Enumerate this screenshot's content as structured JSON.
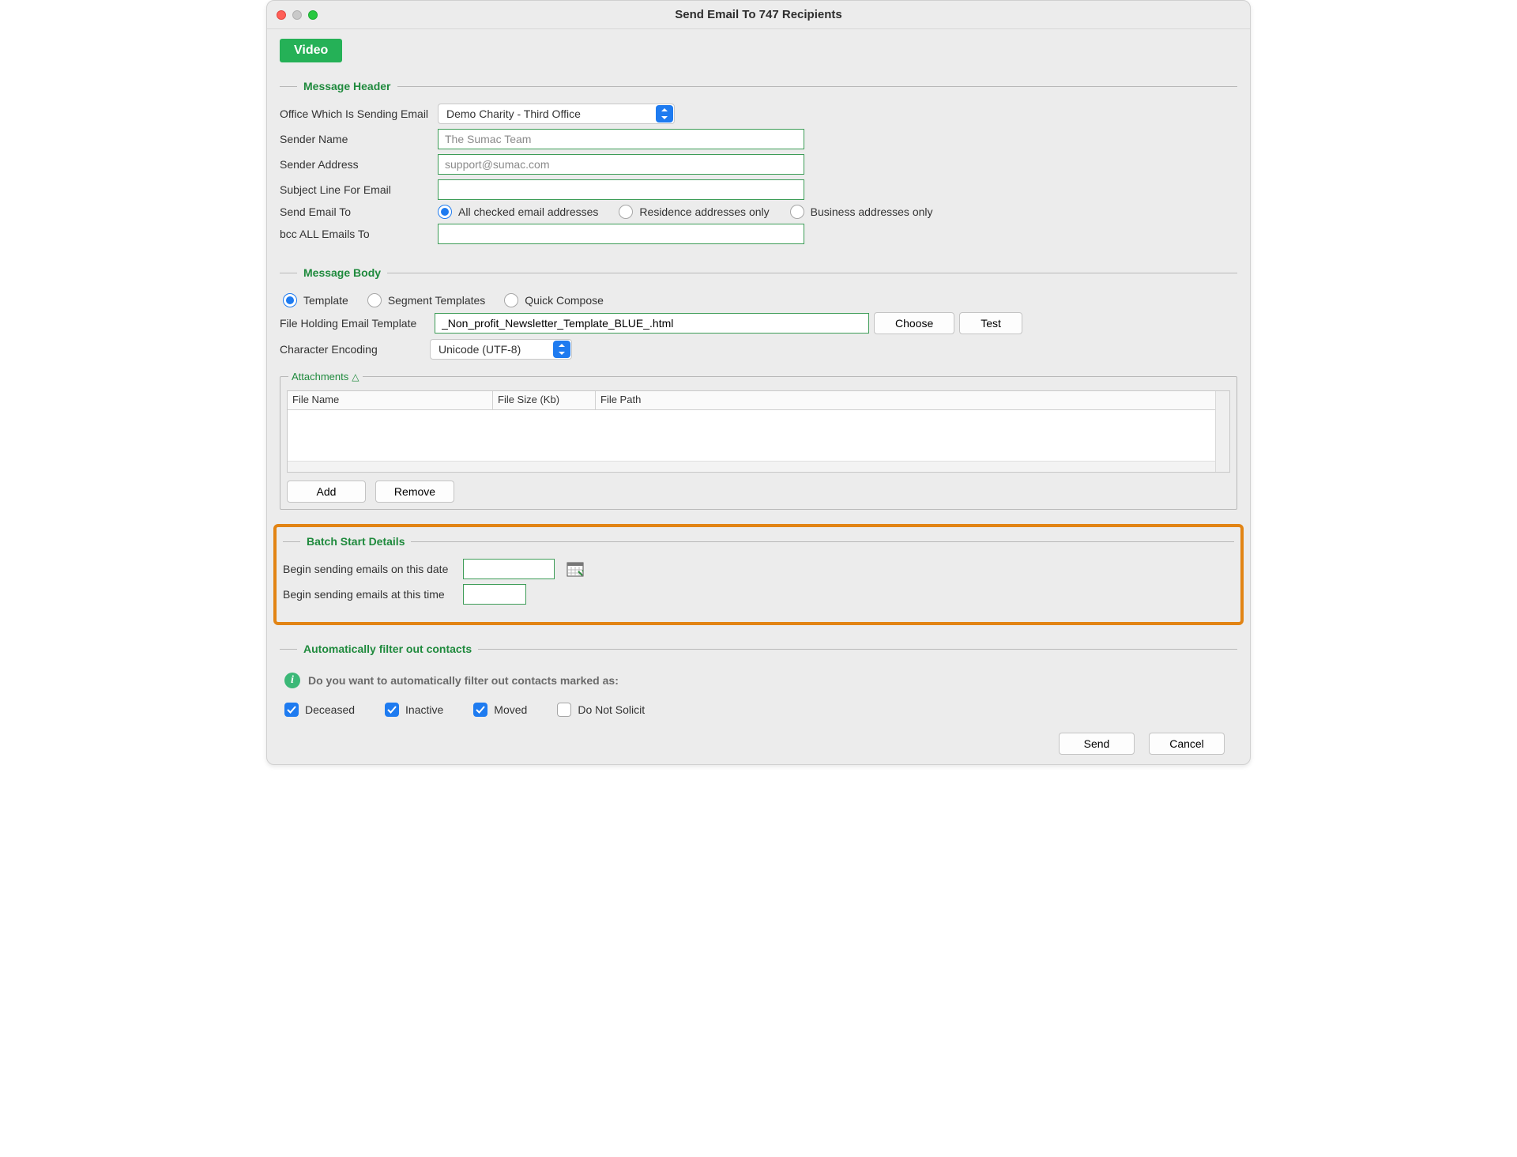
{
  "window": {
    "title": "Send Email To 747 Recipients"
  },
  "video_button": "Video",
  "sections": {
    "header": "Message Header",
    "body": "Message Body",
    "attachments": "Attachments",
    "batch": "Batch Start Details",
    "filter": "Automatically filter out contacts"
  },
  "header": {
    "office_label": "Office Which Is Sending Email",
    "office_value": "Demo Charity - Third Office",
    "sender_name_label": "Sender Name",
    "sender_name_value": "The Sumac Team",
    "sender_addr_label": "Sender Address",
    "sender_addr_value": "support@sumac.com",
    "subject_label": "Subject Line For Email",
    "subject_value": "",
    "send_to_label": "Send Email To",
    "send_to_options": {
      "all": "All checked email addresses",
      "residence": "Residence addresses only",
      "business": "Business addresses only"
    },
    "bcc_label": "bcc ALL Emails To",
    "bcc_value": ""
  },
  "bodysec": {
    "modes": {
      "template": "Template",
      "segment": "Segment Templates",
      "quick": "Quick Compose"
    },
    "file_label": "File Holding Email Template",
    "file_value": "_Non_profit_Newsletter_Template_BLUE_.html",
    "choose": "Choose",
    "test": "Test",
    "encoding_label": "Character Encoding",
    "encoding_value": "Unicode (UTF-8)"
  },
  "attachments": {
    "cols": {
      "name": "File Name",
      "size": "File Size (Kb)",
      "path": "File Path"
    },
    "add": "Add",
    "remove": "Remove"
  },
  "batch": {
    "date_label": "Begin sending emails on this date",
    "time_label": "Begin sending emails at this time"
  },
  "filter": {
    "question": "Do you want to automatically filter out contacts marked as:",
    "deceased": "Deceased",
    "inactive": "Inactive",
    "moved": "Moved",
    "dns": "Do Not Solicit"
  },
  "footer": {
    "send": "Send",
    "cancel": "Cancel"
  }
}
